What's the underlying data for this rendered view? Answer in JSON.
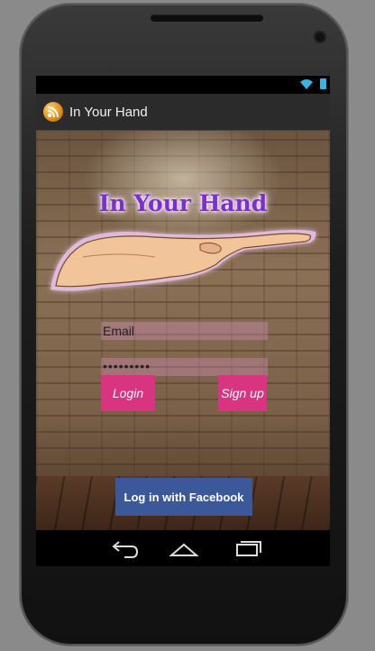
{
  "app": {
    "title": "In Your Hand",
    "icon": "rss-feed-icon"
  },
  "status_bar": {
    "icons": [
      "wifi-icon",
      "battery-icon"
    ]
  },
  "login": {
    "logo_text": "In Your Hand",
    "email_placeholder": "Email",
    "password_value": "•••••••••",
    "login_label": "Login",
    "signup_label": "Sign up",
    "facebook_label": "Log in with Facebook"
  },
  "nav_bar": {
    "buttons": [
      "back-icon",
      "home-icon",
      "recent-apps-icon"
    ]
  },
  "colors": {
    "accent_pink": "#d8347f",
    "facebook_blue": "#3b5998",
    "title_purple": "#7a2fd6",
    "battery_blue": "#33b5e5"
  }
}
